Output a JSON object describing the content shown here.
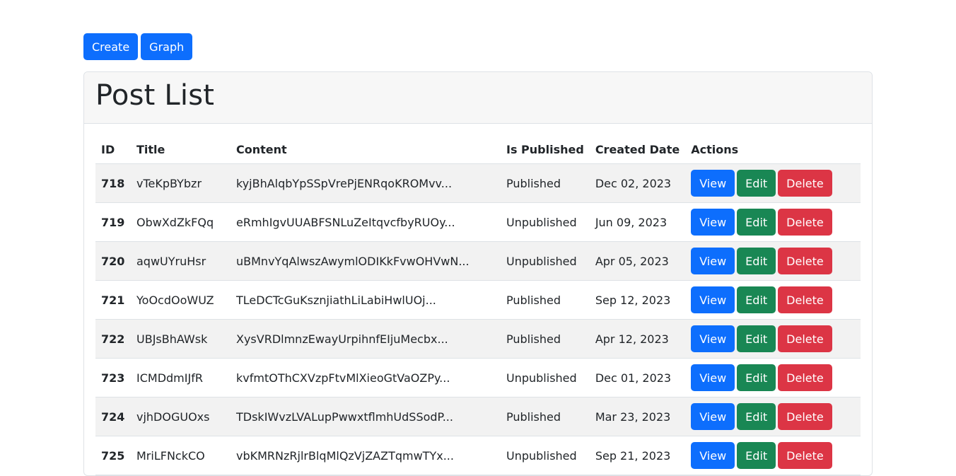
{
  "toolbar": {
    "create_label": "Create",
    "graph_label": "Graph"
  },
  "card": {
    "title": "Post List"
  },
  "table": {
    "headers": {
      "id": "ID",
      "title": "Title",
      "content": "Content",
      "is_published": "Is Published",
      "created_date": "Created Date",
      "actions": "Actions"
    },
    "action_labels": {
      "view": "View",
      "edit": "Edit",
      "delete": "Delete"
    },
    "rows": [
      {
        "id": "718",
        "title": "vTeKpBYbzr",
        "content": "kyjBhAlqbYpSSpVrePjENRqoKROMvv...",
        "status": "Published",
        "date": "Dec 02, 2023"
      },
      {
        "id": "719",
        "title": "ObwXdZkFQq",
        "content": "eRmhIgvUUABFSNLuZeItqvcfbyRUOy...",
        "status": "Unpublished",
        "date": "Jun 09, 2023"
      },
      {
        "id": "720",
        "title": "aqwUYruHsr",
        "content": "uBMnvYqAlwszAwymlODIKkFvwOHVwN...",
        "status": "Unpublished",
        "date": "Apr 05, 2023"
      },
      {
        "id": "721",
        "title": "YoOcdOoWUZ",
        "content": "TLeDCTcGuKsznjiathLiLabiHwlUOj...",
        "status": "Published",
        "date": "Sep 12, 2023"
      },
      {
        "id": "722",
        "title": "UBJsBhAWsk",
        "content": "XysVRDlmnzEwayUrpihnfEIjuMecbx...",
        "status": "Published",
        "date": "Apr 12, 2023"
      },
      {
        "id": "723",
        "title": "ICMDdmIJfR",
        "content": "kvfmtOThCXVzpFtvMlXieoGtVaOZPy...",
        "status": "Unpublished",
        "date": "Dec 01, 2023"
      },
      {
        "id": "724",
        "title": "vjhDOGUOxs",
        "content": "TDskIWvzLVALupPwwxtflmhUdSSodP...",
        "status": "Published",
        "date": "Mar 23, 2023"
      },
      {
        "id": "725",
        "title": "MriLFNckCO",
        "content": "vbKMRNzRjlrBlqMlQzVjZAZTqmwTYx...",
        "status": "Unpublished",
        "date": "Sep 21, 2023"
      }
    ]
  }
}
